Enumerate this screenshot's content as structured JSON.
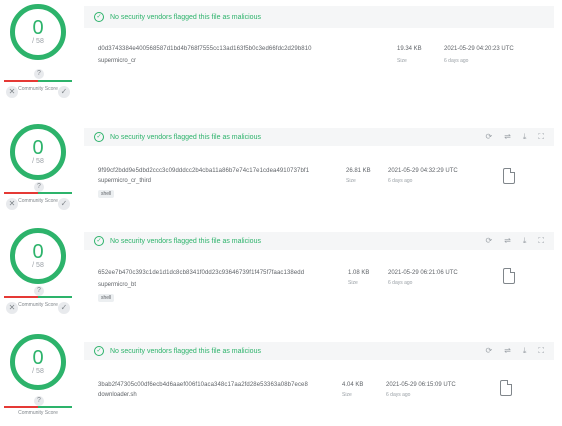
{
  "common": {
    "score": "0",
    "denominator": "/ 58",
    "community_label": "Community Score",
    "banner_text": "No security vendors flagged this file as malicious",
    "size_caption": "Size",
    "qmark": "?",
    "vote_down": "✕",
    "vote_up": "✓",
    "colors": {
      "green": "#2db36b",
      "red": "#e53935"
    },
    "action_icons": [
      "refresh-icon",
      "compare-icon",
      "download-icon",
      "graph-icon"
    ]
  },
  "entries": [
    {
      "hash": "d0d3743384e400568587d1bd4b768f7555cc13ad163f5b0c3ed66fdc2d29b810",
      "filename": "supermicro_cr",
      "tag": "",
      "size": "19.34 KB",
      "date": "2021-05-29 04:20:23 UTC",
      "ago": "6 days ago"
    },
    {
      "hash": "9f99cf2bdd9e5dbd2ccc3c09dddcc2b4cba11a86b7e74c17e1cdea4910737bf1",
      "filename": "supermicro_cr_third",
      "tag": "shell",
      "size": "26.81 KB",
      "date": "2021-05-29 04:32:29 UTC",
      "ago": "6 days ago"
    },
    {
      "hash": "652ee7b470c393c1de1d1dc8cb8341f0dd23c93646739f1f475f7faac138edd",
      "filename": "supermicro_bt",
      "tag": "shell",
      "size": "1.08 KB",
      "date": "2021-05-29 06:21:06 UTC",
      "ago": "6 days ago"
    },
    {
      "hash": "3bab2f47305c00df6ecb4d6aaef006f10aca348c17aa2fd28e53363a08b7ece8",
      "filename": "downloader.sh",
      "tag": "",
      "size": "4.04 KB",
      "date": "2021-05-29 06:15:09 UTC",
      "ago": "6 days ago"
    }
  ]
}
